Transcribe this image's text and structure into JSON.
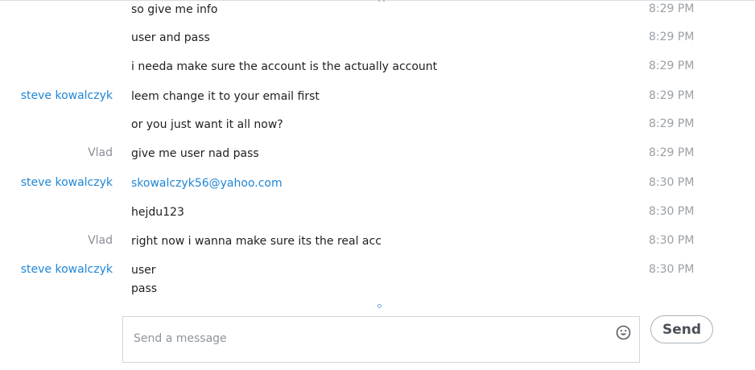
{
  "messages": [
    {
      "sender": "",
      "text": "so give me info",
      "time": "8:29 PM"
    },
    {
      "sender": "",
      "text": "user and pass",
      "time": "8:29 PM"
    },
    {
      "sender": "",
      "text": "i needa make sure the account is the actually account",
      "time": "8:29 PM"
    },
    {
      "sender": "steve kowalczyk",
      "text": "leem change it to your email first",
      "time": "8:29 PM"
    },
    {
      "sender": "",
      "text": "or you just want it all now?",
      "time": "8:29 PM"
    },
    {
      "sender": "Vlad",
      "text": "give me user nad pass",
      "time": "8:29 PM"
    },
    {
      "sender": "steve kowalczyk",
      "text": "skowalczyk56@yahoo.com",
      "time": "8:30 PM"
    },
    {
      "sender": "",
      "text": "hejdu123",
      "time": "8:30 PM"
    },
    {
      "sender": "Vlad",
      "text": "right now i wanna make sure its the real acc",
      "time": "8:30 PM"
    },
    {
      "sender": "steve kowalczyk",
      "text": "user",
      "text2": "pass",
      "time": "8:30 PM"
    }
  ],
  "composer": {
    "placeholder": "Send a message",
    "send_label": "Send"
  },
  "icons": {
    "emoji": "emoji-smiley-icon"
  },
  "colors": {
    "link_blue": "#1f86d6",
    "sender_gray": "#8a8f95",
    "time_gray": "#9aa0a6"
  }
}
